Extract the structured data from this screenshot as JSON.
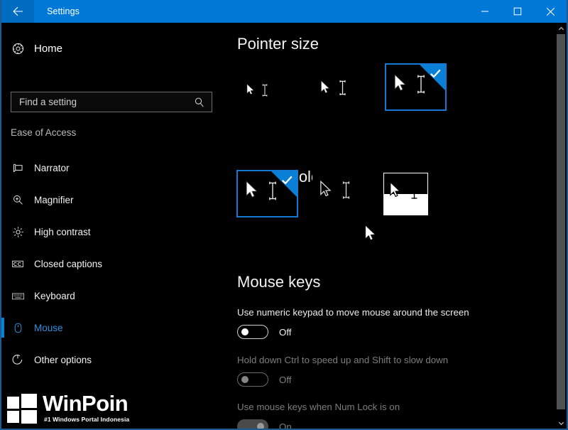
{
  "window": {
    "title": "Settings",
    "back_icon": "back-arrow-icon",
    "minimize_label": "─",
    "maximize_label": "□",
    "close_label": "✕",
    "accent_color": "#0078d7",
    "background_color": "#000000"
  },
  "sidebar": {
    "home": {
      "label": "Home",
      "icon": "gear-icon"
    },
    "search": {
      "placeholder": "Find a setting",
      "value": "",
      "icon": "search-icon"
    },
    "group_label": "Ease of Access",
    "items": [
      {
        "label": "Narrator",
        "icon": "narrator-icon",
        "selected": false
      },
      {
        "label": "Magnifier",
        "icon": "magnifier-icon",
        "selected": false
      },
      {
        "label": "High contrast",
        "icon": "brightness-icon",
        "selected": false
      },
      {
        "label": "Closed captions",
        "icon": "closed-captions-icon",
        "selected": false
      },
      {
        "label": "Keyboard",
        "icon": "keyboard-icon",
        "selected": false
      },
      {
        "label": "Mouse",
        "icon": "mouse-icon",
        "selected": true
      },
      {
        "label": "Other options",
        "icon": "other-options-icon",
        "selected": false
      }
    ],
    "selected_color": "#2f8fe0"
  },
  "content": {
    "pointer_size": {
      "heading": "Pointer size",
      "options": [
        {
          "name": "small",
          "selected": false
        },
        {
          "name": "medium",
          "selected": false
        },
        {
          "name": "large",
          "selected": true
        }
      ]
    },
    "pointer_color": {
      "heading": "Pointer color",
      "options": [
        {
          "name": "white",
          "selected": true
        },
        {
          "name": "black",
          "selected": false
        },
        {
          "name": "inverted",
          "selected": false
        }
      ]
    },
    "mouse_keys": {
      "heading": "Mouse keys",
      "settings": [
        {
          "label": "Use numeric keypad to move mouse around the screen",
          "state": "Off",
          "on": false,
          "disabled": false
        },
        {
          "label": "Hold down Ctrl to speed up and Shift to slow down",
          "state": "Off",
          "on": false,
          "disabled": true
        },
        {
          "label": "Use mouse keys when Num Lock is on",
          "state": "On",
          "on": true,
          "disabled": true
        }
      ]
    },
    "selected_tile_border_color": "#1478d4",
    "check_color": "#ffffff"
  },
  "scrollbar": {
    "up_icon": "chevron-up-icon",
    "down_icon": "chevron-down-icon"
  },
  "watermark": {
    "title": "WinPoin",
    "tagline": "#1 Windows Portal Indonesia"
  }
}
